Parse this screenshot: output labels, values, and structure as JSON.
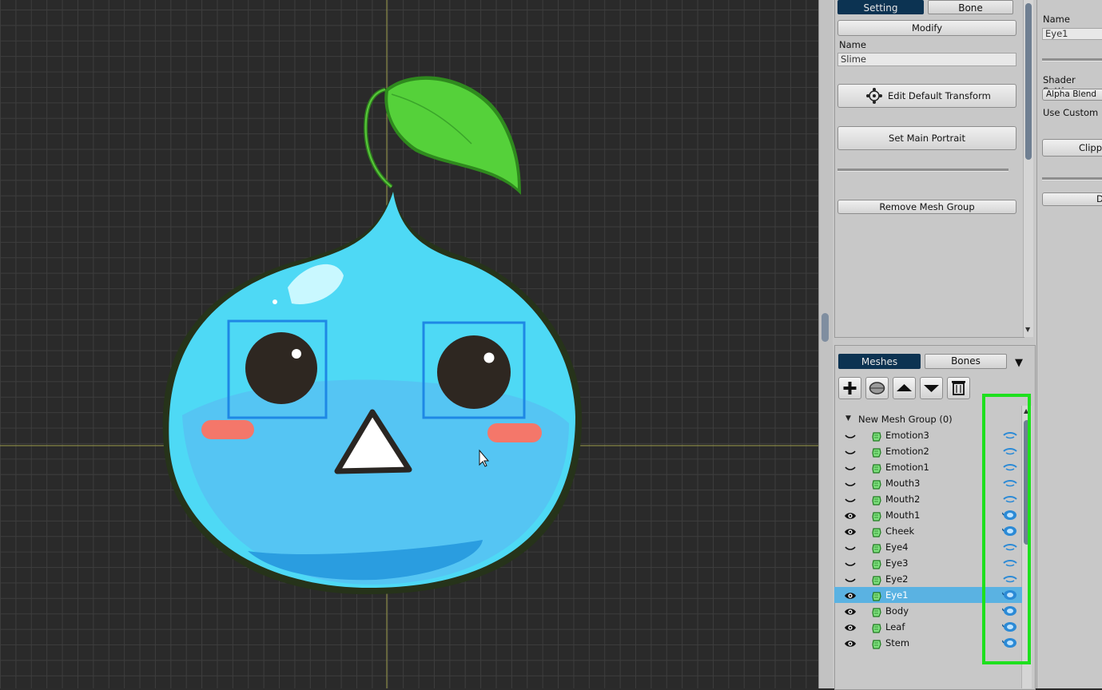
{
  "settings_panel": {
    "tabs": [
      "Setting",
      "Bone"
    ],
    "modify_label": "Modify",
    "name_label": "Name",
    "name_value": "Slime",
    "edit_default_transform_label": "Edit Default Transform",
    "set_main_portrait_label": "Set Main Portrait",
    "remove_mesh_group_label": "Remove Mesh Group"
  },
  "hierarchy_panel": {
    "tabs": [
      "Meshes",
      "Bones"
    ],
    "toolbar_icons": [
      "add-icon",
      "mesh-icon",
      "move-up-icon",
      "move-down-icon",
      "trash-icon"
    ],
    "group_label": "New Mesh Group (0)",
    "items": [
      {
        "label": "Emotion3",
        "visible": false,
        "selected": false
      },
      {
        "label": "Emotion2",
        "visible": false,
        "selected": false
      },
      {
        "label": "Emotion1",
        "visible": false,
        "selected": false
      },
      {
        "label": "Mouth3",
        "visible": false,
        "selected": false
      },
      {
        "label": "Mouth2",
        "visible": false,
        "selected": false
      },
      {
        "label": "Mouth1",
        "visible": true,
        "selected": false
      },
      {
        "label": "Cheek",
        "visible": true,
        "selected": false
      },
      {
        "label": "Eye4",
        "visible": false,
        "selected": false
      },
      {
        "label": "Eye3",
        "visible": false,
        "selected": false
      },
      {
        "label": "Eye2",
        "visible": false,
        "selected": false
      },
      {
        "label": "Eye1",
        "visible": true,
        "selected": true
      },
      {
        "label": "Body",
        "visible": true,
        "selected": false
      },
      {
        "label": "Leaf",
        "visible": true,
        "selected": false
      },
      {
        "label": "Stem",
        "visible": true,
        "selected": false
      }
    ]
  },
  "properties_panel": {
    "name_label": "Name",
    "name_value": "Eye1",
    "shader_label": "Shader Settin",
    "shader_value": "Alpha Blend",
    "use_custom_label": "Use Custom",
    "clipping_label": "Clippi",
    "cut_button_label": "De"
  },
  "colors": {
    "accent_tab": "#0c3352",
    "selection": "#5ab2e2",
    "highlight": "#1ee01e",
    "canvas_bg": "#2a2a2a",
    "slime_body": "#4fd8f5",
    "selection_box": "#1e88e5"
  }
}
